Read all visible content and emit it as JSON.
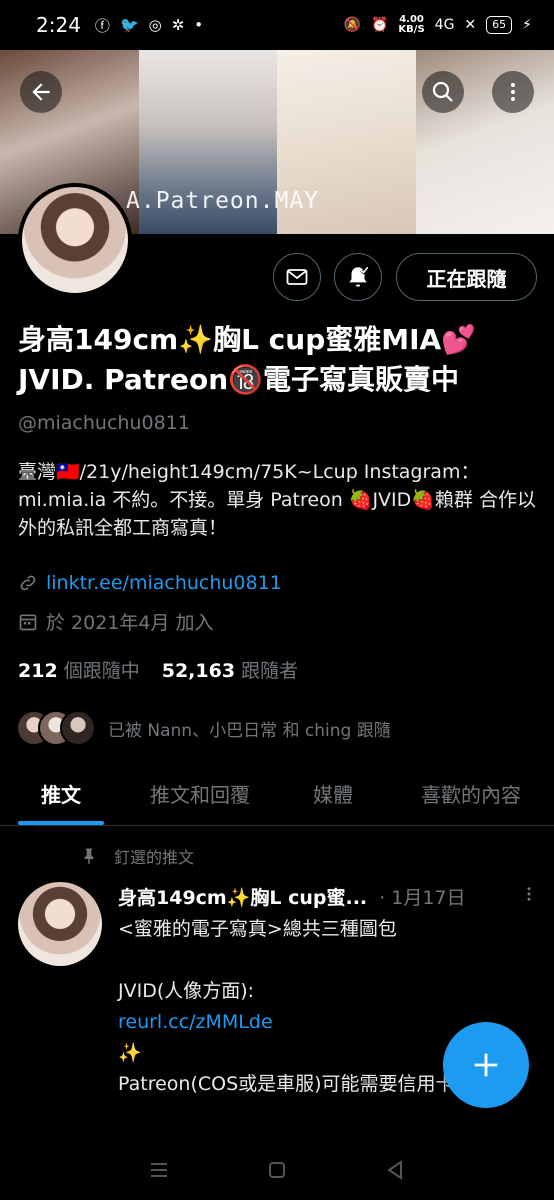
{
  "status": {
    "time": "2:24",
    "speed_value": "4.00",
    "speed_unit": "KB/S",
    "network": "4G",
    "battery": "65"
  },
  "banner": {
    "watermark": "A.Patreon.MAY"
  },
  "profile": {
    "follow_button": "正在跟隨",
    "name_line1": "身高149cm✨胸L cup蜜雅MIA💕",
    "name_line2": "JVID. Patreon🔞電子寫真販賣中",
    "handle": "@miachuchu0811",
    "bio": "臺灣🇹🇼/21y/height149cm/75K~Lcup Instagram：mi.mia.ia  不約。不接。單身 Patreon 🍓JVID🍓賴群 合作以外的私訊全都工商寫真！",
    "link": "linktr.ee/miachuchu0811",
    "joined": "於 2021年4月 加入",
    "following_count": "212",
    "following_label": "個跟隨中",
    "followers_count": "52,163",
    "followers_label": "跟隨者",
    "followed_by": "已被 Nann、小巴日常 和 ching 跟隨"
  },
  "tabs": [
    {
      "label": "推文"
    },
    {
      "label": "推文和回覆"
    },
    {
      "label": "媒體"
    },
    {
      "label": "喜歡的內容"
    }
  ],
  "tweet": {
    "pinned_label": "釘選的推文",
    "author": "身高149cm✨胸L cup蜜...",
    "date": "· 1月17日",
    "line1": "<蜜雅的電子寫真>總共三種圖包",
    "line2": "JVID(人像方面):",
    "link": "reurl.cc/zMMLde",
    "line3": "✨",
    "line4": "Patreon(COS或是車服)可能需要信用卡:"
  }
}
